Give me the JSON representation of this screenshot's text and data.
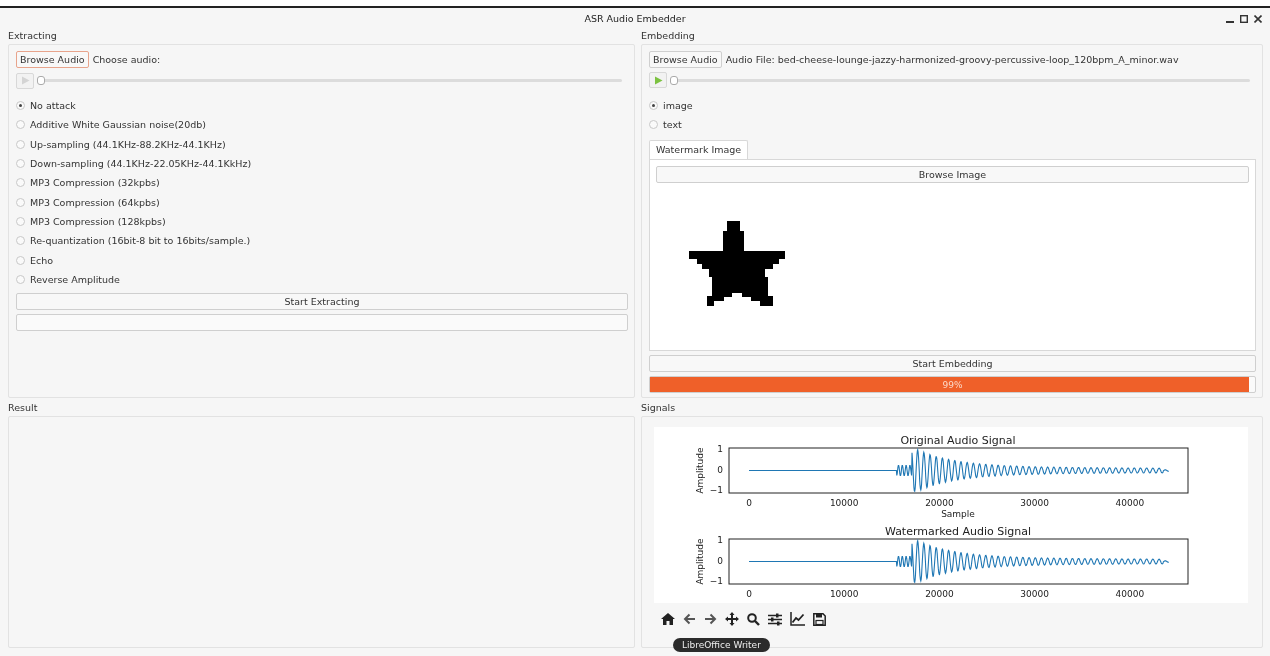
{
  "window": {
    "title": "ASR Audio Embedder"
  },
  "extracting": {
    "title": "Extracting",
    "browse_button": "Browse Audio",
    "audio_label": "Choose audio:",
    "player": {
      "enabled": false,
      "level": 0
    },
    "attacks": [
      {
        "label": "No attack",
        "selected": true
      },
      {
        "label": "Additive White Gaussian noise(20db)",
        "selected": false
      },
      {
        "label": "Up-sampling (44.1KHz-88.2KHz-44.1KHz)",
        "selected": false
      },
      {
        "label": "Down-sampling (44.1KHz-22.05KHz-44.1KkHz)",
        "selected": false
      },
      {
        "label": "MP3 Compression (32kpbs)",
        "selected": false
      },
      {
        "label": "MP3 Compression (64kpbs)",
        "selected": false
      },
      {
        "label": "MP3 Compression (128kpbs)",
        "selected": false
      },
      {
        "label": "Re-quantization (16bit-8 bit to 16bits/sample.)",
        "selected": false
      },
      {
        "label": "Echo",
        "selected": false
      },
      {
        "label": "Reverse Amplitude",
        "selected": false
      }
    ],
    "start_button": "Start Extracting"
  },
  "embedding": {
    "title": "Embedding",
    "browse_button": "Browse Audio",
    "audio_label": "Audio File: bed-cheese-lounge-jazzy-harmonized-groovy-percussive-loop_120bpm_A_minor.wav",
    "player": {
      "enabled": true,
      "level": 0
    },
    "modes": [
      {
        "label": "image",
        "selected": true
      },
      {
        "label": "text",
        "selected": false
      }
    ],
    "tabs": [
      {
        "label": "Watermark Image",
        "selected": true
      }
    ],
    "browse_image_button": "Browse Image",
    "start_button": "Start Embedding",
    "progress": {
      "level": 0.99,
      "text": "99%"
    }
  },
  "result": {
    "title": "Result"
  },
  "signals": {
    "title": "Signals",
    "plots": [
      {
        "title": "Original Audio Signal",
        "ylabel": "Amplitude",
        "xlabel": "Sample",
        "xticks": [
          "0",
          "10000",
          "20000",
          "30000",
          "40000"
        ],
        "yticks": [
          "1",
          "0",
          "−1"
        ]
      },
      {
        "title": "Watermarked Audio Signal",
        "ylabel": "Amplitude",
        "xticks": [
          "0",
          "10000",
          "20000",
          "30000",
          "40000"
        ],
        "yticks": [
          "1",
          "0",
          "−1"
        ]
      }
    ]
  },
  "tooltip": "LibreOffice Writer"
}
